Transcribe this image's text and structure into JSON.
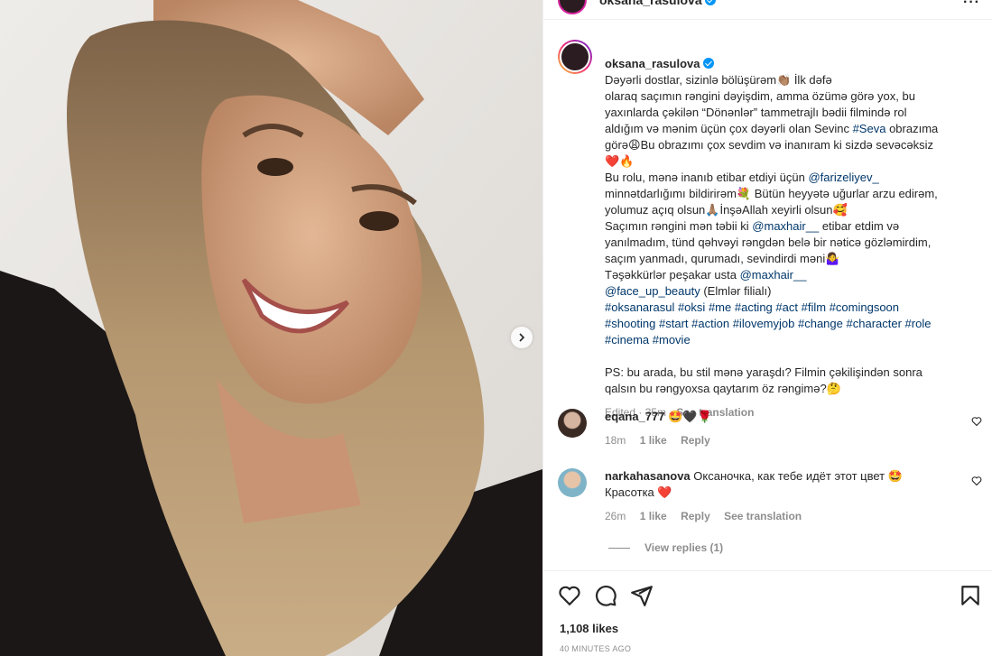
{
  "post": {
    "username": "oksana_rasulova",
    "caption_lines": [
      "Dəyərli dostlar, sizinlə bölüşürəm👏🏽 İlk dəfə",
      "olaraq saçımın rəngini dəyişdim, amma özümə görə yox, bu",
      "yaxınlarda çəkilən “Dönənlər” tammetrajlı bədii filmində rol",
      "aldığım və mənim üçün çox dəyərli olan Sevinc #Seva obrazıma",
      "görə😩Bu obrazımı çox sevdim və inanıram ki sizdə sevəcəksiz",
      "❤️🔥",
      "Bu rolu, mənə inanıb etibar etdiyi üçün @farizeliyev_",
      "minnətdarlığımı bildirirəm💐 Bütün heyyətə uğurlar arzu edirəm,",
      "yolumuz açıq olsun🙏🏽İnşəAllah xeyirli olsun🥰",
      "Saçımın rəngini mən təbii ki @maxhair__ etibar etdim və",
      "yanılmadım, tünd qəhvəyi rəngdən belə bir nəticə gözləmirdim,",
      "saçım yanmadı, qurumadı, sevindirdi məni🤷‍♀️",
      "Təşəkkürlər peşakar usta @maxhair__",
      "@face_up_beauty (Elmlər filialı)",
      "#oksanarasul #oksi #me #acting #act #film #comingsoon",
      "#shooting #start #action #ilovemyjob #change #character #role",
      "#cinema #movie",
      "",
      "PS: bu arada, bu stil mənə yaraşdı? Filmin çəkilişindən sonra",
      "qalsın bu rəngyoxsa qaytarım öz rəngimə?🤔"
    ],
    "edited_time": "Edited · 35m",
    "see_translation": "See translation"
  },
  "comments": [
    {
      "username": "eqana_777",
      "text": "🤩🖤🌹",
      "time": "18m",
      "likes": "1 like",
      "reply": "Reply"
    },
    {
      "username": "narkahasanova",
      "text": "Оксаночка, как тебе идёт этот цвет 🤩",
      "text2": "Красотка ❤️",
      "time": "26m",
      "likes": "1 like",
      "reply": "Reply",
      "see_translation": "See translation"
    }
  ],
  "view_replies": "View replies (1)",
  "likes_count": "1,108 likes",
  "posted_time": "40 MINUTES AGO",
  "colors": {
    "link": "#00376b",
    "muted": "#8e8e8e",
    "verified": "#0095f6"
  }
}
